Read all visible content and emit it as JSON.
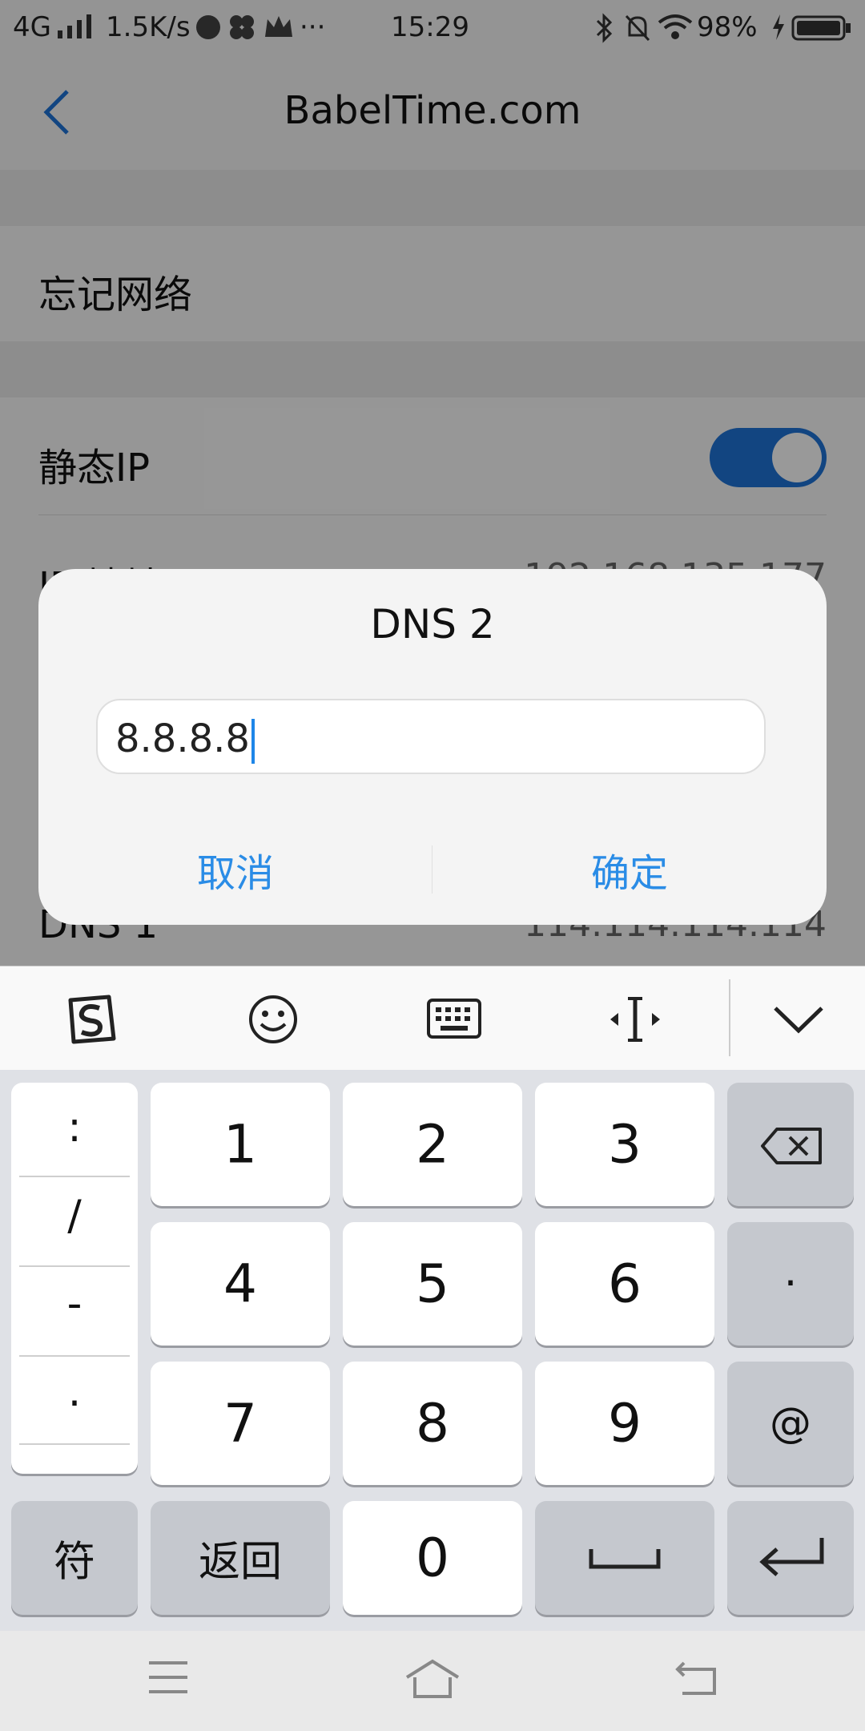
{
  "status_bar": {
    "network": "4G",
    "speed": "1.5K/s",
    "more": "···",
    "time": "15:29",
    "battery": "98%"
  },
  "nav": {
    "title": "BabelTime.com"
  },
  "settings": {
    "forget_network": "忘记网络",
    "static_ip": "静态IP",
    "static_ip_on": true,
    "ip_address_label": "IP 地址",
    "ip_address_value": "192.168.135.177",
    "dns1_label": "DNS 1",
    "dns1_value": "114.114.114.114"
  },
  "dialog": {
    "title": "DNS 2",
    "input_value": "8.8.8.8",
    "cancel": "取消",
    "confirm": "确定"
  },
  "keyboard": {
    "side_symbols": [
      ":",
      "/",
      "-",
      "."
    ],
    "row1": [
      "1",
      "2",
      "3"
    ],
    "row2": [
      "4",
      "5",
      "6"
    ],
    "row3": [
      "7",
      "8",
      "9"
    ],
    "dot_key": "·",
    "at_key": "@",
    "sym_key": "符",
    "back_key": "返回",
    "zero_key": "0"
  },
  "colors": {
    "accent": "#2a8ce6",
    "toggle": "#1e73d7"
  }
}
